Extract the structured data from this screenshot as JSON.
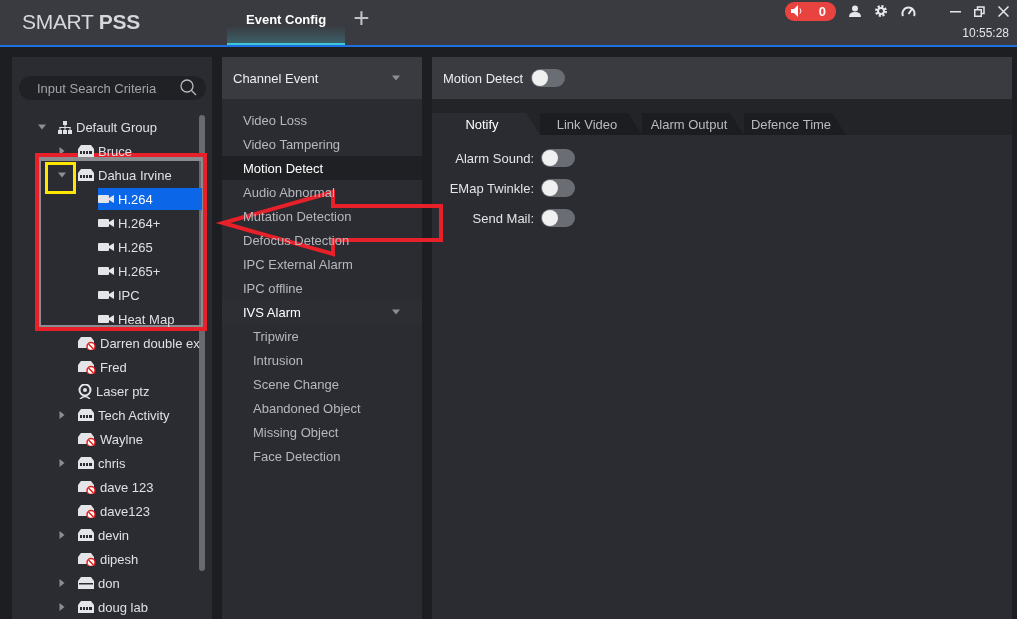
{
  "app": {
    "logo": "SMART **PSS**",
    "tabs": [
      {
        "label": "Event Config",
        "selected": true
      }
    ],
    "add_tab": "+",
    "alarm_count": "0",
    "time": "10:55:28"
  },
  "device_tree": {
    "search": {
      "placeholder": "Input Search Criteria"
    },
    "nodes": [
      {
        "label": "Default Group",
        "kind": "group",
        "expanded": true,
        "children": [
          {
            "label": "Bruce",
            "kind": "dvr",
            "expanded": false
          },
          {
            "label": "Dahua Irvine",
            "kind": "dvr",
            "expanded": true,
            "children": [
              {
                "label": "H.264",
                "kind": "camera",
                "selected": true
              },
              {
                "label": "H.264+",
                "kind": "camera",
                "selected": false
              },
              {
                "label": "H.265",
                "kind": "camera",
                "selected": false
              },
              {
                "label": "H.265+",
                "kind": "camera",
                "selected": false
              },
              {
                "label": "IPC",
                "kind": "camera",
                "selected": false
              },
              {
                "label": "Heat Map",
                "kind": "camera",
                "selected": false
              }
            ]
          },
          {
            "label": "Darren double ex",
            "kind": "offline"
          },
          {
            "label": "Fred",
            "kind": "offline"
          },
          {
            "label": "Laser ptz",
            "kind": "ptz"
          },
          {
            "label": "Tech Activity",
            "kind": "dvr",
            "expanded": false
          },
          {
            "label": "Waylne",
            "kind": "offline"
          },
          {
            "label": "chris",
            "kind": "dvr",
            "expanded": false
          },
          {
            "label": "dave 123",
            "kind": "offline"
          },
          {
            "label": "dave123",
            "kind": "offline"
          },
          {
            "label": "devin",
            "kind": "dvr",
            "expanded": false
          },
          {
            "label": "dipesh",
            "kind": "offline"
          },
          {
            "label": "don",
            "kind": "nvr",
            "expanded": false
          },
          {
            "label": "doug lab",
            "kind": "dvr",
            "expanded": false
          }
        ]
      }
    ]
  },
  "event_list": {
    "title": "Channel Event",
    "items": [
      {
        "label": "Video Loss",
        "selected": false
      },
      {
        "label": "Video Tampering",
        "selected": false
      },
      {
        "label": "Motion Detect",
        "selected": true
      },
      {
        "label": "Audio Abnormal",
        "selected": false
      },
      {
        "label": "Mutation Detection",
        "selected": false
      },
      {
        "label": "Defocus Detection",
        "selected": false
      },
      {
        "label": "IPC External Alarm",
        "selected": false
      },
      {
        "label": "IPC offline",
        "selected": false
      },
      {
        "label": "IVS Alarm",
        "selected": false,
        "expanded": true,
        "children": [
          {
            "label": "Tripwire",
            "selected": false
          },
          {
            "label": "Intrusion",
            "selected": false
          },
          {
            "label": "Scene Change",
            "selected": false
          },
          {
            "label": "Abandoned Object",
            "selected": false
          },
          {
            "label": "Missing Object",
            "selected": false
          },
          {
            "label": "Face Detection",
            "selected": false
          }
        ]
      }
    ]
  },
  "config": {
    "title": "Motion Detect",
    "enabled": false,
    "tabs": [
      {
        "label": "Notify",
        "selected": true
      },
      {
        "label": "Link Video",
        "selected": false
      },
      {
        "label": "Alarm Output",
        "selected": false
      },
      {
        "label": "Defence Time",
        "selected": false
      }
    ],
    "settings": [
      {
        "label": "Alarm Sound:",
        "on": false
      },
      {
        "label": "EMap Twinkle:",
        "on": false
      },
      {
        "label": "Send Mail:",
        "on": false
      }
    ]
  },
  "annotations": [
    {
      "kind": "frame",
      "color": "#e8202a"
    },
    {
      "kind": "frame",
      "color": "#ffe600"
    },
    {
      "kind": "arrow",
      "color": "#e8202a"
    }
  ]
}
